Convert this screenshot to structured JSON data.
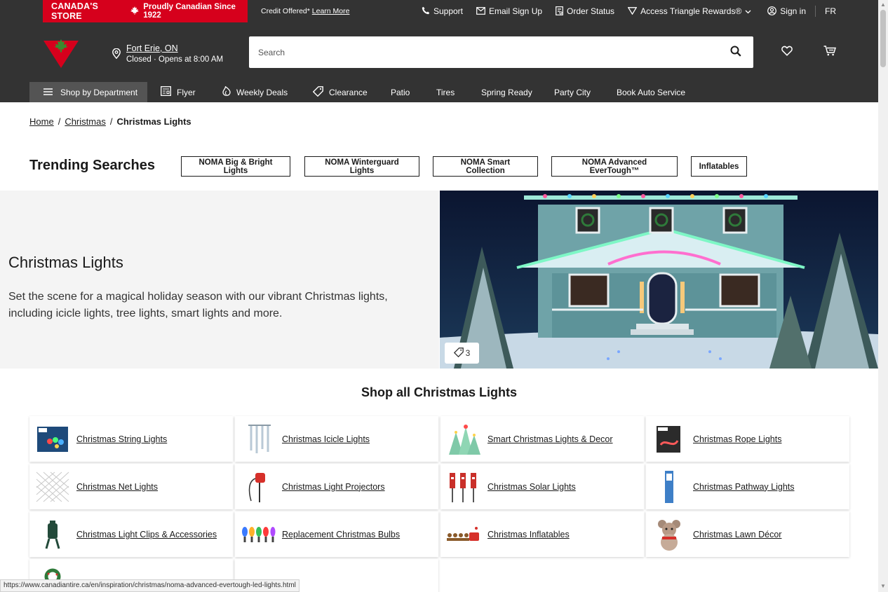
{
  "topbar": {
    "brand": "CANADA'S STORE",
    "tagline": "Proudly Canadian Since 1922",
    "credit_text": "Credit Offered*",
    "credit_link": "Learn More",
    "links": {
      "support": "Support",
      "email": "Email Sign Up",
      "order": "Order Status",
      "rewards": "Access Triangle Rewards®",
      "signin": "Sign in",
      "lang": "FR"
    }
  },
  "header": {
    "store_city": "Fort Erie, ON",
    "store_hours": "Closed · Opens at 8:00 AM",
    "search_placeholder": "Search"
  },
  "nav": {
    "department": "Shop by Department",
    "flyer": "Flyer",
    "weekly": "Weekly Deals",
    "clearance": "Clearance",
    "patio": "Patio",
    "tires": "Tires",
    "spring": "Spring Ready",
    "party": "Party City",
    "auto": "Book Auto Service"
  },
  "breadcrumb": {
    "home": "Home",
    "christmas": "Christmas",
    "current": "Christmas Lights"
  },
  "trending": {
    "title": "Trending Searches",
    "items": [
      "NOMA Big & Bright Lights",
      "NOMA Winterguard Lights",
      "NOMA Smart Collection",
      "NOMA Advanced EverTough™",
      "Inflatables"
    ]
  },
  "hero": {
    "title": "Christmas Lights",
    "description": "Set the scene for a magical holiday season with our vibrant Christmas lights, including icicle lights, tree lights, smart lights and more.",
    "tag_count": "3"
  },
  "shop": {
    "title": "Shop all Christmas Lights",
    "categories": [
      "Christmas String Lights",
      "Christmas Icicle Lights",
      "Smart Christmas Lights & Decor",
      "Christmas Rope Lights",
      "Christmas Net Lights",
      "Christmas Light Projectors",
      "Christmas Solar Lights",
      "Christmas Pathway Lights",
      "Christmas Light Clips & Accessories",
      "Replacement Christmas Bulbs",
      "Christmas Inflatables",
      "Christmas Lawn Décor"
    ]
  },
  "status_url": "https://www.canadiantire.ca/en/inspiration/christmas/noma-advanced-evertough-led-lights.html",
  "colors": {
    "brand_red": "#d6001c",
    "header_bg": "#333333",
    "dept_bg": "#545454"
  }
}
